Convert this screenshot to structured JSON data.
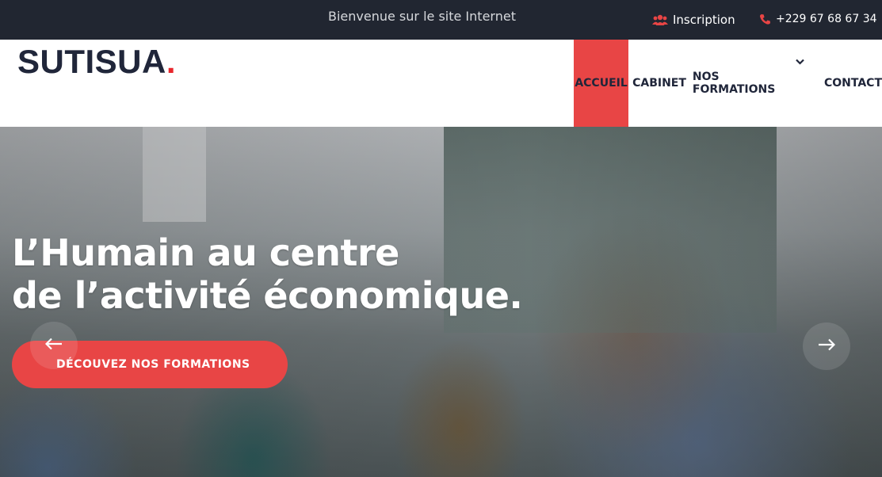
{
  "topbar": {
    "welcome": "Bienvenue sur le site Internet",
    "signup_label": "Inscription",
    "signup_icon": "users-icon",
    "phone": "+229 67 68 67 34",
    "phone_icon": "phone-icon"
  },
  "header": {
    "logo_text": "SUTISUA",
    "logo_dot": ".",
    "nav": [
      {
        "label": "ACCUEIL",
        "active": true
      },
      {
        "label": "CABINET"
      },
      {
        "label": "NOS FORMATIONS",
        "has_dropdown": true
      },
      {
        "label": "CONTACT"
      }
    ]
  },
  "hero": {
    "title_line1": "L’Humain au centre",
    "title_line2": "de l’activité économique.",
    "cta_label": "DÉCOUVEZ NOS FORMATIONS",
    "prev_icon": "arrow-left-icon",
    "next_icon": "arrow-right-icon"
  },
  "colors": {
    "accent": "#e84545",
    "topbar_bg": "#212631",
    "text_dark": "#20263a"
  }
}
